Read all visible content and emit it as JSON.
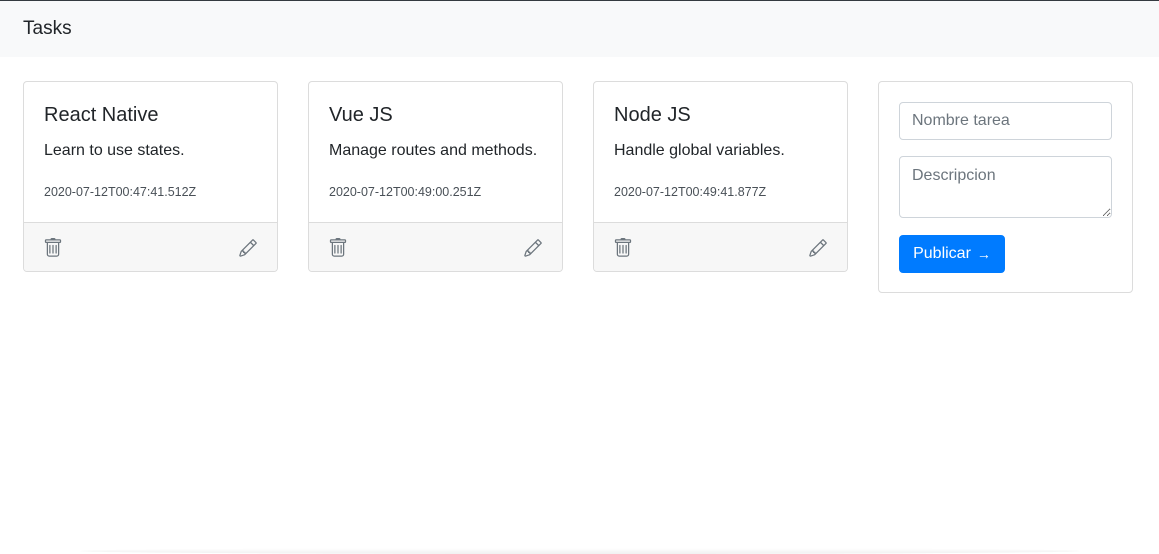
{
  "navbar": {
    "brand": "Tasks"
  },
  "tasks": [
    {
      "title": "React Native",
      "description": "Learn to use states.",
      "date": "2020-07-12T00:47:41.512Z"
    },
    {
      "title": "Vue JS",
      "description": "Manage routes and methods.",
      "date": "2020-07-12T00:49:00.251Z"
    },
    {
      "title": "Node JS",
      "description": "Handle global variables.",
      "date": "2020-07-12T00:49:41.877Z"
    }
  ],
  "form": {
    "name_placeholder": "Nombre tarea",
    "description_placeholder": "Descripcion",
    "submit_label": "Publicar",
    "submit_arrow": "→"
  },
  "colors": {
    "primary": "#007bff",
    "navbar_bg": "#f8f9fa",
    "footer_bg": "#f7f7f7",
    "icon": "#6c757d"
  },
  "icons": {
    "delete": "trash-icon",
    "edit": "pencil-icon"
  }
}
